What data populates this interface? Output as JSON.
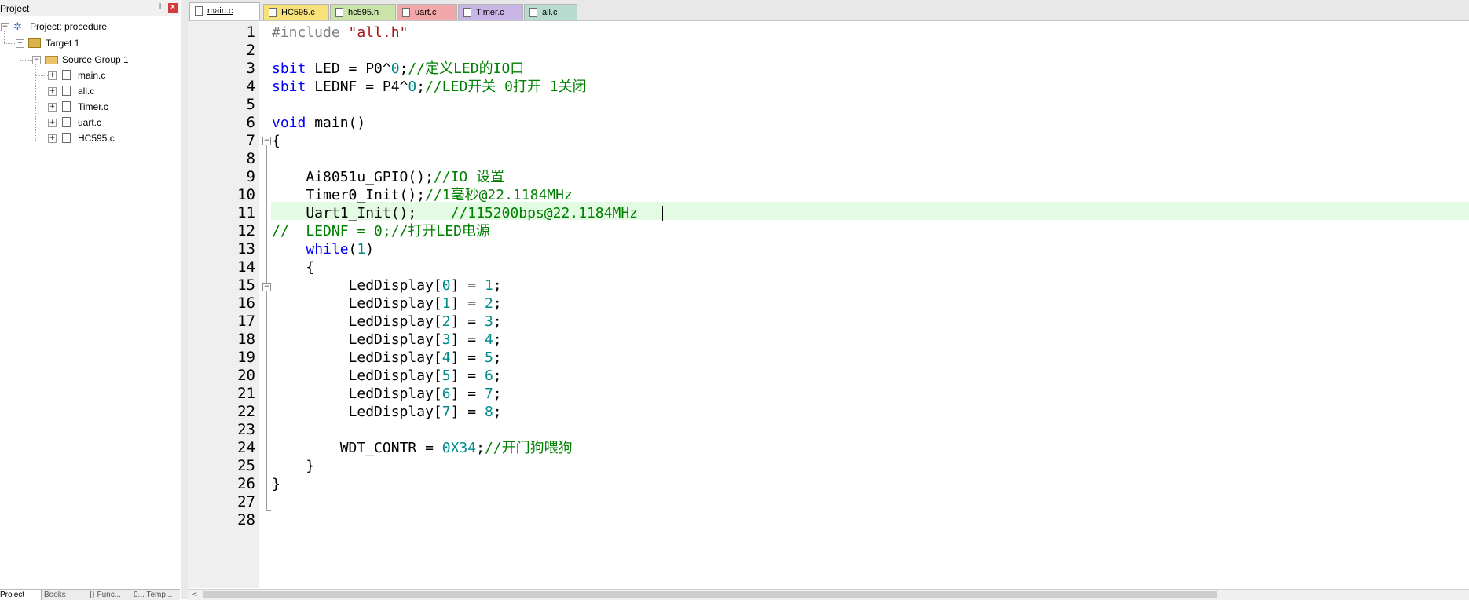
{
  "project_panel": {
    "title": "Project",
    "pin_glyph": "⊥",
    "close_glyph": "×",
    "tree": {
      "project_label": "Project: procedure",
      "target_label": "Target 1",
      "group_label": "Source Group 1",
      "files": [
        "main.c",
        "all.c",
        "Timer.c",
        "uart.c",
        "HC595.c"
      ]
    },
    "bottom_tabs": [
      "Project",
      "Books",
      "{} Func...",
      "0... Temp..."
    ]
  },
  "editor": {
    "tabs": [
      {
        "label": "main.c",
        "color": "#ffffff"
      },
      {
        "label": "HC595.c",
        "color": "#f7e27a"
      },
      {
        "label": "hc595.h",
        "color": "#c9e3a9"
      },
      {
        "label": "uart.c",
        "color": "#f2a8a8"
      },
      {
        "label": "Timer.c",
        "color": "#c8b5e6"
      },
      {
        "label": "all.c",
        "color": "#b7dccf"
      }
    ],
    "active_tab": "main.c",
    "current_line": 11,
    "lines": [
      "1",
      "2",
      "3",
      "4",
      "5",
      "6",
      "7",
      "8",
      "9",
      "10",
      "11",
      "12",
      "13",
      "14",
      "15",
      "16",
      "17",
      "18",
      "19",
      "20",
      "21",
      "22",
      "23",
      "24",
      "25",
      "26",
      "27",
      "28"
    ],
    "code": {
      "l1_pre": "#include ",
      "l1_str": "\"all.h\"",
      "l3_kw": "sbit",
      "l3_code": " LED = P0^",
      "l3_num": "0",
      "l3_semi": ";",
      "l3_cm": "//定义LED的IO口",
      "l4_kw": "sbit",
      "l4_code": " LEDNF = P4^",
      "l4_num": "0",
      "l4_semi": ";",
      "l4_cm": "//LED开关 0打开 1关闭",
      "l6_kw": "void",
      "l6_code": " main()",
      "l7": "{",
      "l9_code": "    Ai8051u_GPIO();",
      "l9_cm": "//IO 设置",
      "l10_code": "    Timer0_Init();",
      "l10_cm": "//1毫秒@22.1184MHz",
      "l11_code": "    Uart1_Init();    ",
      "l11_cm": "//115200bps@22.1184MHz",
      "l12_cm": "//  LEDNF = 0;//打开LED电源",
      "l13_ind": "    ",
      "l13_kw": "while",
      "l13_p1": "(",
      "l13_num": "1",
      "l13_p2": ")",
      "l14": "    {",
      "disp": [
        {
          "pre": "         LedDisplay[",
          "i": "0",
          "mid": "] = ",
          "v": "1",
          "end": ";"
        },
        {
          "pre": "         LedDisplay[",
          "i": "1",
          "mid": "] = ",
          "v": "2",
          "end": ";"
        },
        {
          "pre": "         LedDisplay[",
          "i": "2",
          "mid": "] = ",
          "v": "3",
          "end": ";"
        },
        {
          "pre": "         LedDisplay[",
          "i": "3",
          "mid": "] = ",
          "v": "4",
          "end": ";"
        },
        {
          "pre": "         LedDisplay[",
          "i": "4",
          "mid": "] = ",
          "v": "5",
          "end": ";"
        },
        {
          "pre": "         LedDisplay[",
          "i": "5",
          "mid": "] = ",
          "v": "6",
          "end": ";"
        },
        {
          "pre": "         LedDisplay[",
          "i": "6",
          "mid": "] = ",
          "v": "7",
          "end": ";"
        },
        {
          "pre": "         LedDisplay[",
          "i": "7",
          "mid": "] = ",
          "v": "8",
          "end": ";"
        }
      ],
      "l24_code": "        WDT_CONTR = ",
      "l24_num": "0X34",
      "l24_semi": ";",
      "l24_cm": "//开门狗喂狗",
      "l25": "    }",
      "l26": "}"
    }
  },
  "scrollbar": {
    "left_arrow": "<"
  }
}
